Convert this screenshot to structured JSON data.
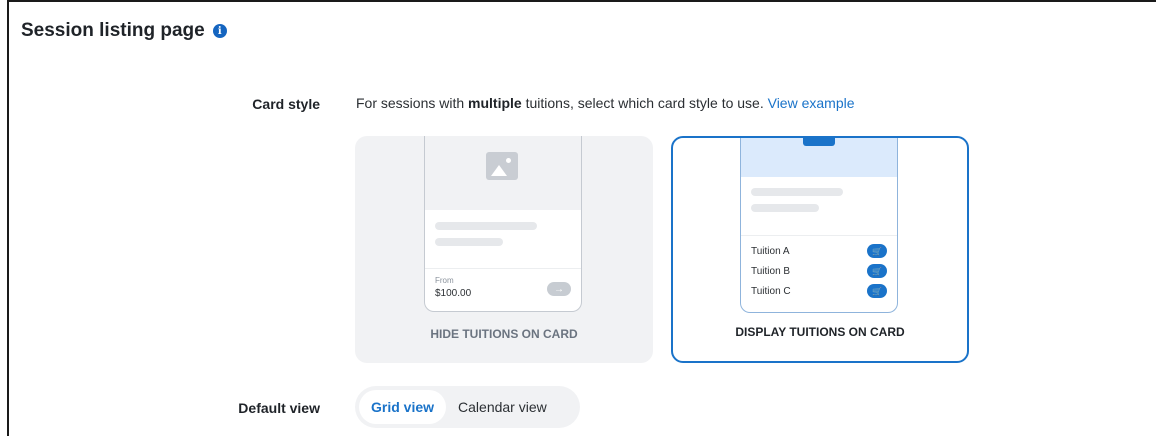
{
  "section": {
    "title": "Session listing page",
    "info_glyph": "i"
  },
  "card_style": {
    "label": "Card style",
    "desc_prefix": "For sessions with ",
    "desc_bold": "multiple",
    "desc_suffix": " tuitions, select which card style to use. ",
    "desc_link": "View example",
    "options": [
      {
        "caption": "HIDE TUITIONS ON CARD",
        "from_label": "From",
        "price": "$100.00",
        "arrow": "→",
        "selected": false
      },
      {
        "caption": "DISPLAY TUITIONS ON CARD",
        "tuitions": [
          "Tuition A",
          "Tuition B",
          "Tuition C"
        ],
        "cart_glyph": "🛒",
        "selected": true
      }
    ]
  },
  "default_view": {
    "label": "Default view",
    "options": [
      "Grid view",
      "Calendar view"
    ],
    "selected": "Grid view"
  },
  "colors": {
    "accent": "#1a73c9",
    "info": "#1565c0",
    "card_bg": "#f1f2f4"
  }
}
